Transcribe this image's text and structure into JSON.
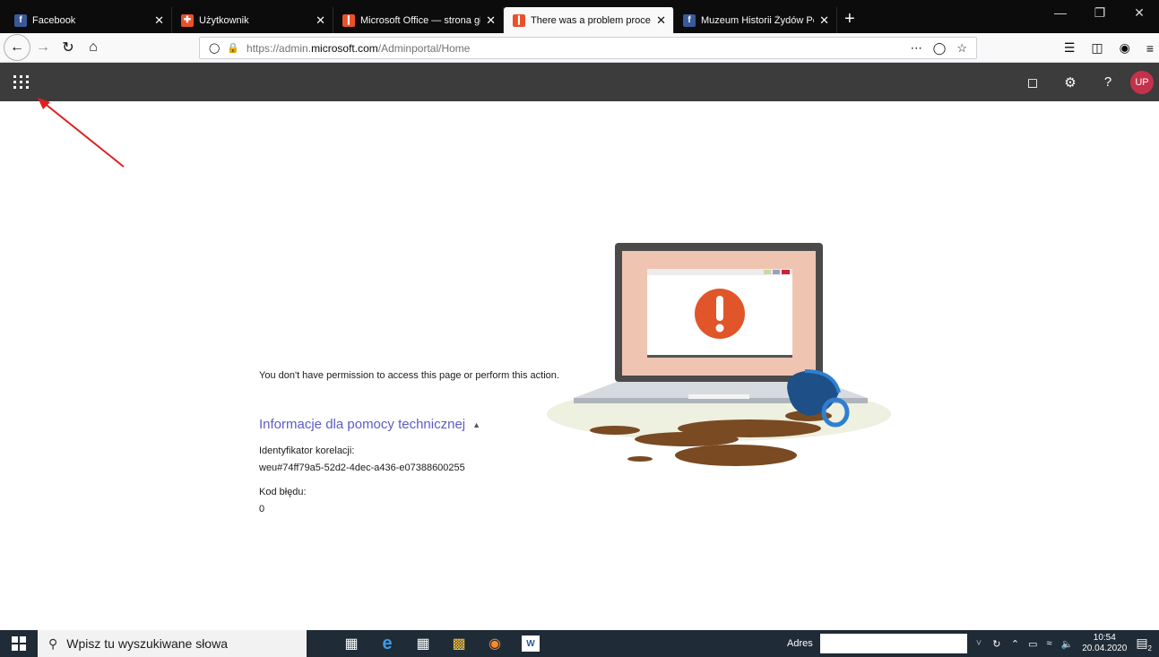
{
  "browser": {
    "tabs": [
      {
        "label": "Facebook",
        "icon": "facebook-icon",
        "color": "#3b5998",
        "glyph": "f",
        "active": false
      },
      {
        "label": "Użytkownik",
        "icon": "office-user-icon",
        "color": "#e8512b",
        "glyph": "✚",
        "active": false
      },
      {
        "label": "Microsoft Office — strona głów",
        "icon": "office-icon",
        "color": "#e8512b",
        "glyph": "❙",
        "active": false
      },
      {
        "label": "There was a problem processin",
        "icon": "office-icon",
        "color": "#e8512b",
        "glyph": "❙",
        "active": true
      },
      {
        "label": "Muzeum Historii Żydów Polskic",
        "icon": "facebook-icon",
        "color": "#3b5998",
        "glyph": "f",
        "active": false
      }
    ],
    "url_prefix": "https://admin.",
    "url_domain": "microsoft.com",
    "url_path": "/Adminportal/Home"
  },
  "header": {
    "avatar_initials": "UP",
    "help_glyph": "?"
  },
  "content": {
    "message": "You don't have permission to access this page or perform this action.",
    "support_link": "Informacje dla pomocy technicznej",
    "correlation_label": "Identyfikator korelacji:",
    "correlation_value": "weu#74ff79a5-52d2-4dec-a436-e07388600255",
    "error_code_label": "Kod błędu:",
    "error_code_value": "0"
  },
  "taskbar": {
    "search_placeholder": "Wpisz tu wyszukiwane słowa",
    "address_label": "Adres",
    "time": "10:54",
    "date": "20.04.2020",
    "notification_count": "2"
  },
  "colors": {
    "accent_link": "#5c5cc6",
    "header_bg": "#3c3c3c",
    "avatar_bg": "#c4314b",
    "error_circle": "#e0562a",
    "arrow": "#e02020"
  }
}
